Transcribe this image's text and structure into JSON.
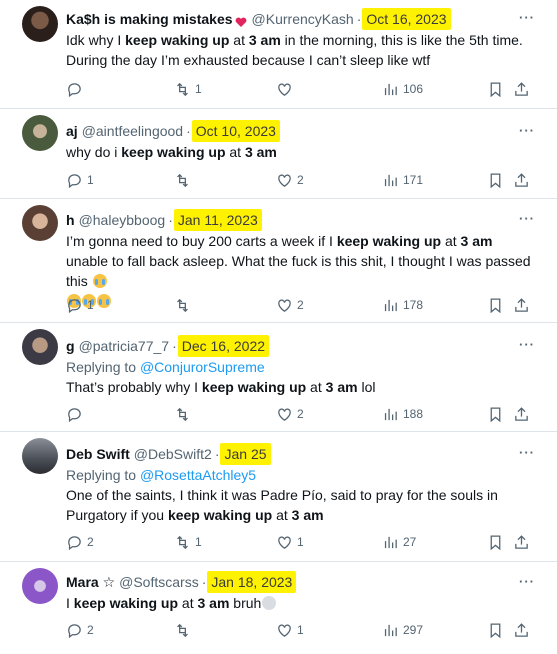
{
  "tweets": [
    {
      "name": "Ka$h is making mistakes",
      "handle": "@KurrencyKash",
      "date": "Oct 16, 2023",
      "text_before": "Idk why I ",
      "phrase": "keep waking up",
      "text_mid": " at ",
      "time": "3 am",
      "text_after": " in the morning, this is like the 5th time. During the day I’m exhausted because I can’t sleep like wtf",
      "replies": "",
      "retweets": "1",
      "likes": "",
      "views": "106"
    },
    {
      "name": "aj",
      "handle": "@aintfeelingood",
      "date": "Oct 10, 2023",
      "text_before": "why do i ",
      "phrase": "keep waking up",
      "text_mid": " at ",
      "time": "3 am",
      "text_after": "",
      "replies": "1",
      "retweets": "",
      "likes": "2",
      "views": "171"
    },
    {
      "name": "h",
      "handle": "@haleybboog",
      "date": "Jan 11, 2023",
      "text_before": "I’m gonna need to buy 200 carts a week if I ",
      "phrase": "keep waking up",
      "text_mid": " at ",
      "time": "3 am",
      "text_after": " unable to fall back asleep. What the fuck is this shit, I thought I was passed this",
      "replies": "1",
      "retweets": "",
      "likes": "2",
      "views": "178"
    },
    {
      "name": "g",
      "handle": "@patricia77_7",
      "date": "Dec 16, 2022",
      "reply_label": "Replying to ",
      "reply_to": "@ConjurorSupreme",
      "text_before": "That’s probably why I ",
      "phrase": "keep waking up",
      "text_mid": " at ",
      "time": "3 am",
      "text_after": " lol",
      "replies": "",
      "retweets": "",
      "likes": "2",
      "views": "188"
    },
    {
      "name": "Deb Swift",
      "handle": "@DebSwift2",
      "date": "Jan 25",
      "reply_label": "Replying to ",
      "reply_to": "@RosettaAtchley5",
      "text_before": "One of the saints, I think it was Padre Pío, said to pray for the souls in Purgatory if you ",
      "phrase": "keep waking up",
      "text_mid": " at ",
      "time": "3 am",
      "text_after": "",
      "replies": "2",
      "retweets": "1",
      "likes": "1",
      "views": "27"
    },
    {
      "name": "Mara ☆",
      "handle": "@Softscarss",
      "date": "Jan 18, 2023",
      "text_before": "I ",
      "phrase": "keep waking up",
      "text_mid": " at ",
      "time": "3 am",
      "text_after": " bruh",
      "replies": "2",
      "retweets": "",
      "likes": "1",
      "views": "297"
    }
  ],
  "colors": {
    "highlight": "#fff200",
    "link": "#1d9bf0",
    "muted": "#536471",
    "text": "#0f1419"
  },
  "icons": [
    "more-icon",
    "reply-icon",
    "retweet-icon",
    "like-icon",
    "views-icon",
    "bookmark-icon",
    "share-icon"
  ]
}
